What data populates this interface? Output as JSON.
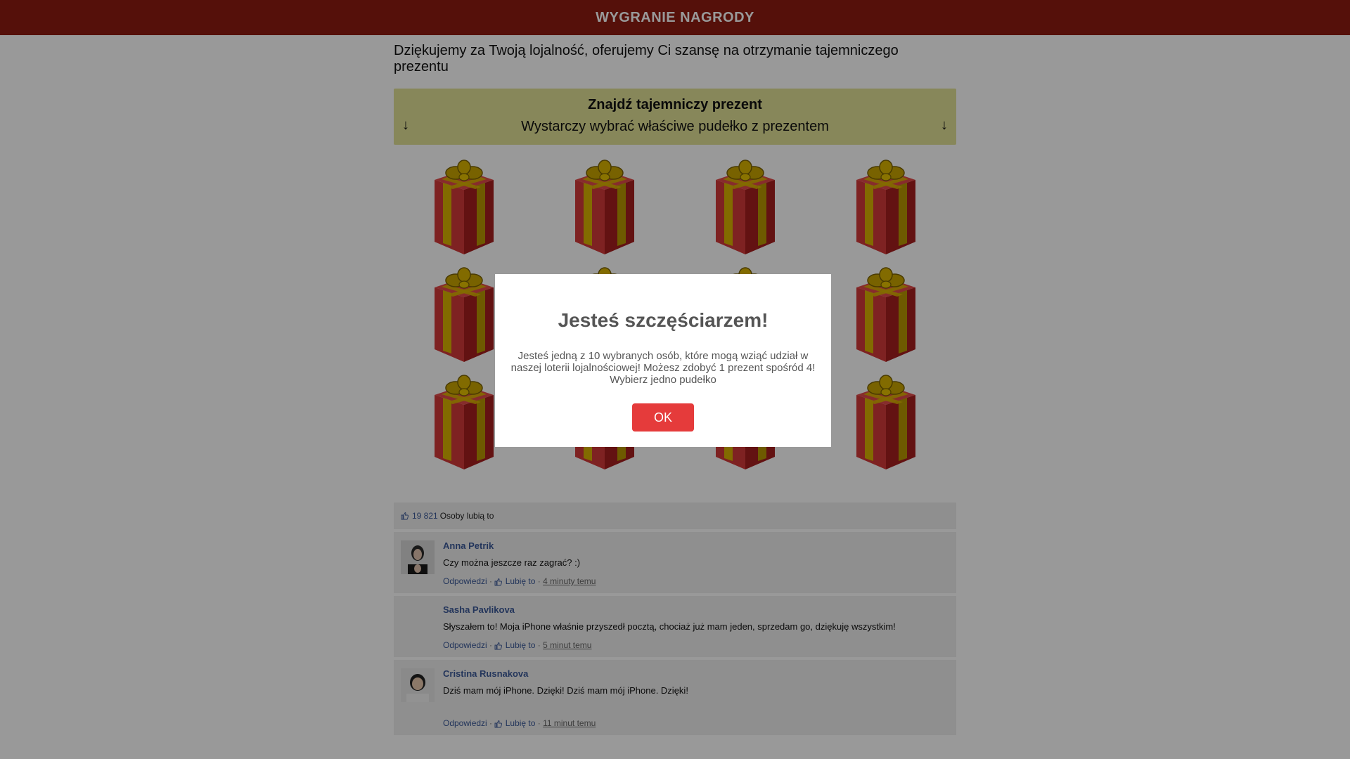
{
  "header": {
    "title": "WYGRANIE NAGRODY"
  },
  "intro": "Dziękujemy za Twoją lojalność, oferujemy Ci szansę na otrzymanie tajemniczego prezentu",
  "banner": {
    "title": "Znajdź tajemniczy prezent",
    "subtitle": "Wystarczy wybrać właściwe pudełko z prezentem",
    "arrow": "↓"
  },
  "colors": {
    "header": "#8e1b12",
    "banner": "#e2e296",
    "gift_box": "#c82a2a",
    "ribbon": "#d9b200",
    "ok_button": "#e53b3b",
    "link": "#3b5998"
  },
  "gifts": {
    "count": 12,
    "icon": "gift-box-icon"
  },
  "likes": {
    "count": "19 821",
    "label": "Osoby lubią to"
  },
  "comments": [
    {
      "name": "Anna Petrik",
      "text": "Czy można jeszcze raz zagrać? :)",
      "reply": "Odpowiedzi",
      "like": "Lubię to",
      "time": "4 minuty temu"
    },
    {
      "name": "Sasha Pavlikova",
      "text": "Słyszałem to! Moja iPhone właśnie przyszedł pocztą, chociaż już mam jeden, sprzedam go, dziękuję wszystkim!",
      "reply": "Odpowiedzi",
      "like": "Lubię to",
      "time": "5 minut temu"
    },
    {
      "name": "Cristina Rusnakova",
      "text": "Dziś mam mój iPhone. Dzięki! Dziś mam mój iPhone. Dzięki!",
      "reply": "Odpowiedzi",
      "like": "Lubię to",
      "time": "11 minut temu"
    }
  ],
  "modal": {
    "title": "Jesteś szczęściarzem!",
    "text": "Jesteś jedną z 10 wybranych osób, które mogą wziąć udział w naszej loterii lojalnościowej! Możesz zdobyć 1 prezent spośród 4! Wybierz jedno pudełko",
    "ok": "OK"
  }
}
